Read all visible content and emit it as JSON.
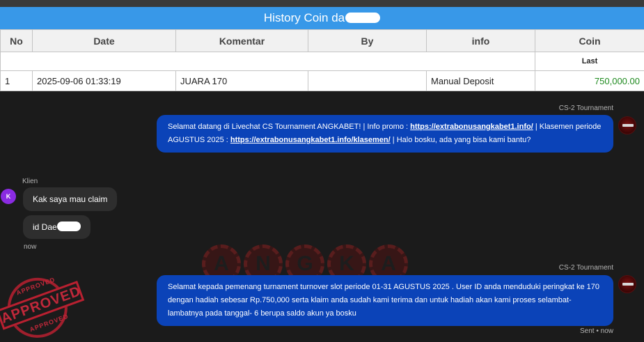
{
  "history": {
    "title_prefix": "History Coin da",
    "columns": [
      "No",
      "Date",
      "Komentar",
      "By",
      "info",
      "Coin"
    ],
    "last_label": "Last",
    "rows": [
      {
        "no": "1",
        "date": "2025-09-06 01:33:19",
        "komentar": "JUARA 170",
        "by": "",
        "info": "Manual Deposit",
        "coin": "750,000.00"
      }
    ]
  },
  "chat": {
    "agent_name": "CS-2 Tournament",
    "client_name": "Klien",
    "client_initial": "K",
    "messages": {
      "m1": {
        "t1": "Selamat datang di Livechat CS Tournament ANGKABET! | Info promo : ",
        "link1": "https://extrabonusangkabet1.info/",
        "t2": " | Klasemen periode AGUSTUS 2025 : ",
        "link2": "https://extrabonusangkabet1.info/klasemen/",
        "t3": " | Halo bosku, ada yang bisa kami bantu?"
      },
      "client1": "Kak saya mau claim",
      "client2": "id Dae",
      "client_time": "now",
      "m2": "Selamat kepada pemenang turnament turnover slot periode 01-31 AGUSTUS 2025 . User ID anda menduduki peringkat ke 170 dengan hadiah sebesar Rp.750,000 serta klaim anda sudah kami terima dan untuk hadiah akan kami proses selambat-lambatnya pada tanggal- 6 berupa saldo akun ya bosku",
      "m2_status": "Sent • now"
    }
  },
  "watermark": {
    "letters": [
      "A",
      "N",
      "G",
      "K",
      "A"
    ]
  },
  "stamp": {
    "top": "APPROVED",
    "main": "APPROVED",
    "bottom": "APPROVED"
  },
  "colors": {
    "header_blue": "#3898e8",
    "agent_bubble": "#0b43b8",
    "coin_green": "#1e8a1e",
    "stamp_red": "#b82030"
  }
}
